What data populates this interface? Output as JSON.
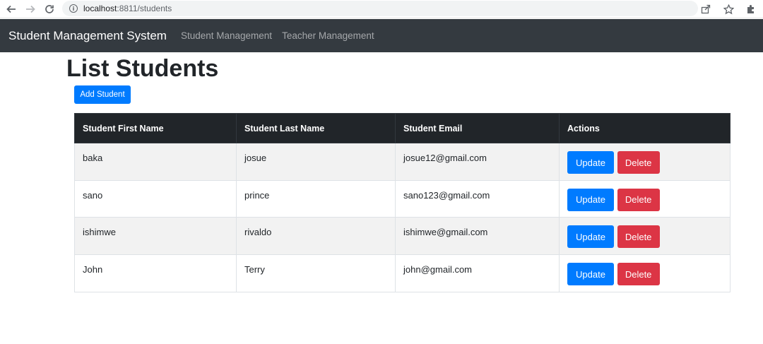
{
  "browser": {
    "url_host": "localhost",
    "url_path": ":8811/students"
  },
  "navbar": {
    "brand": "Student Management System",
    "links": [
      "Student Management",
      "Teacher Management"
    ]
  },
  "page": {
    "title": "List Students",
    "add_button": "Add Student"
  },
  "table": {
    "headers": [
      "Student First Name",
      "Student Last Name",
      "Student Email",
      "Actions"
    ],
    "rows": [
      {
        "first": "baka",
        "last": "josue",
        "email": "josue12@gmail.com"
      },
      {
        "first": "sano",
        "last": "prince",
        "email": "sano123@gmail.com"
      },
      {
        "first": "ishimwe",
        "last": "rivaldo",
        "email": "ishimwe@gmail.com"
      },
      {
        "first": "John",
        "last": "Terry",
        "email": "john@gmail.com"
      }
    ],
    "update_label": "Update",
    "delete_label": "Delete"
  },
  "colors": {
    "navbar_bg": "#343a40",
    "primary": "#007bff",
    "danger": "#dc3545",
    "table_header_bg": "#212529"
  }
}
